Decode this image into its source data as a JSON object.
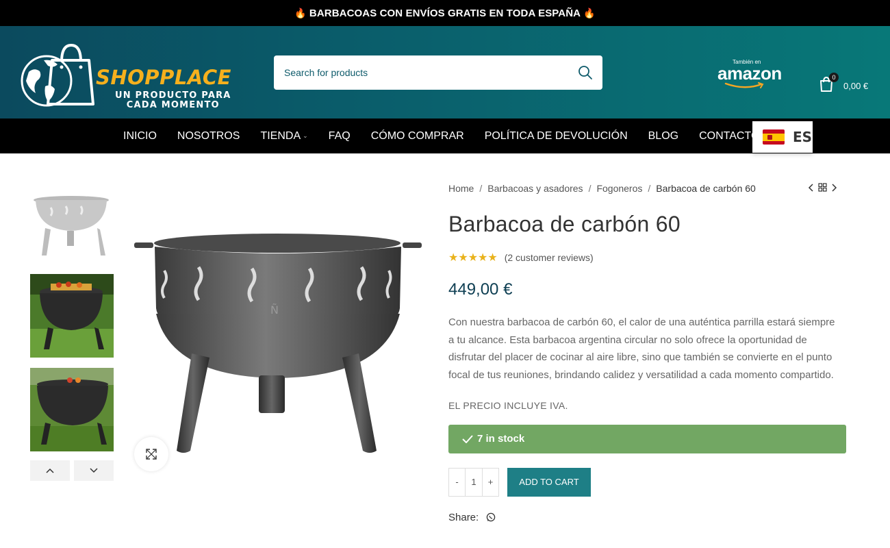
{
  "announcement": {
    "text": "BARBACOAS CON ENVÍOS GRATIS EN TODA ESPAÑA"
  },
  "logo": {
    "name": "SHOPPLACE",
    "tagline_1": "UN PRODUCTO PARA",
    "tagline_2": "CADA MOMENTO"
  },
  "search": {
    "placeholder": "Search for products"
  },
  "amazon": {
    "small": "También en",
    "word": "amazon"
  },
  "cart": {
    "count": "0",
    "total": "0,00 €"
  },
  "nav": {
    "items": [
      "INICIO",
      "NOSOTROS",
      "TIENDA",
      "FAQ",
      "CÓMO COMPRAR",
      "POLÍTICA DE DEVOLUCIÓN",
      "BLOG",
      "CONTACTO"
    ]
  },
  "language": {
    "code": "ES"
  },
  "breadcrumb": {
    "home": "Home",
    "cat1": "Barbacoas y asadores",
    "cat2": "Fogoneros",
    "current": "Barbacoa de carbón 60"
  },
  "product": {
    "title": "Barbacoa de carbón 60",
    "rating": 5,
    "reviews": "(2 customer reviews)",
    "price": "449,00 €",
    "description": "Con nuestra barbacoa de carbón 60, el calor de una auténtica parrilla estará siempre a tu alcance. Esta barbacoa argentina circular no solo ofrece la oportunidad de disfrutar del placer de cocinar al aire libre, sino que también se convierte en el punto focal de tus reuniones, brindando calidez y versatilidad a cada momento compartido.",
    "iva_note": "EL PRECIO INCLUYE IVA.",
    "stock": "7 in stock",
    "quantity": "1",
    "add_to_cart": "ADD TO CART",
    "qty_minus": "-",
    "qty_plus": "+"
  },
  "share": {
    "label": "Share:"
  },
  "icons": [
    "flame-icon",
    "globe-bag-logo",
    "search-icon",
    "cart-icon",
    "spain-flag-icon",
    "star-icon",
    "expand-icon",
    "chevron-up-icon",
    "chevron-down-icon",
    "chevron-left-icon",
    "chevron-right-icon",
    "grid-icon",
    "check-icon",
    "whatsapp-icon"
  ],
  "colors": {
    "header_from": "#0b4a5e",
    "header_to": "#087878",
    "logo_gold": "#f5b01d",
    "stock_green": "#72a763",
    "cart_button": "#1e7f86",
    "price": "#0d3e52",
    "stars": "#e9b21b"
  }
}
